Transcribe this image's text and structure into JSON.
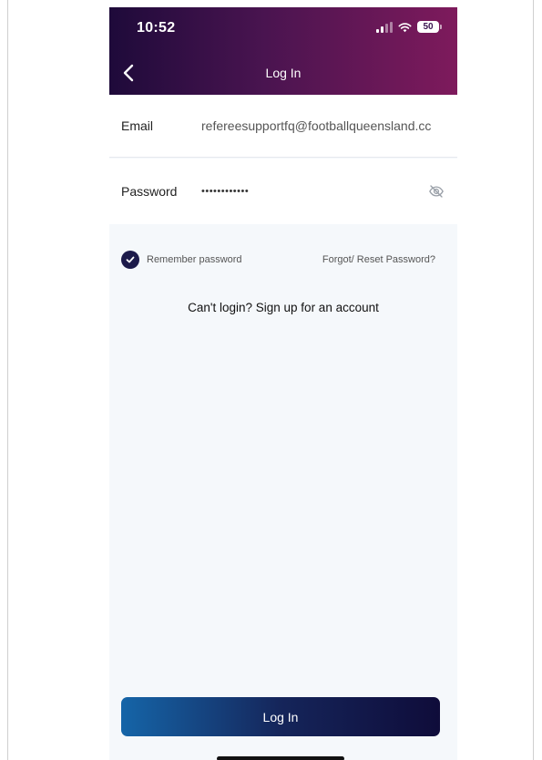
{
  "status_bar": {
    "time": "10:52",
    "battery": "50"
  },
  "nav": {
    "title": "Log In",
    "back_icon": "chevron-left-icon"
  },
  "form": {
    "email": {
      "label": "Email",
      "value": "refereesupportfq@footballqueensland.cc"
    },
    "password": {
      "label": "Password",
      "value": "••••••••••••",
      "toggle_icon": "eye-off-icon"
    }
  },
  "options": {
    "remember_label": "Remember password",
    "remember_checked": true,
    "forgot_label": "Forgot/ Reset Password?"
  },
  "signup_label": "Can't login? Sign up for an account",
  "login_button_label": "Log In",
  "colors": {
    "header_start": "#1e0a3a",
    "header_end": "#7e1a5c",
    "button_start": "#1565a8",
    "button_end": "#0f0c3a",
    "checkbox": "#1c1a4a"
  }
}
